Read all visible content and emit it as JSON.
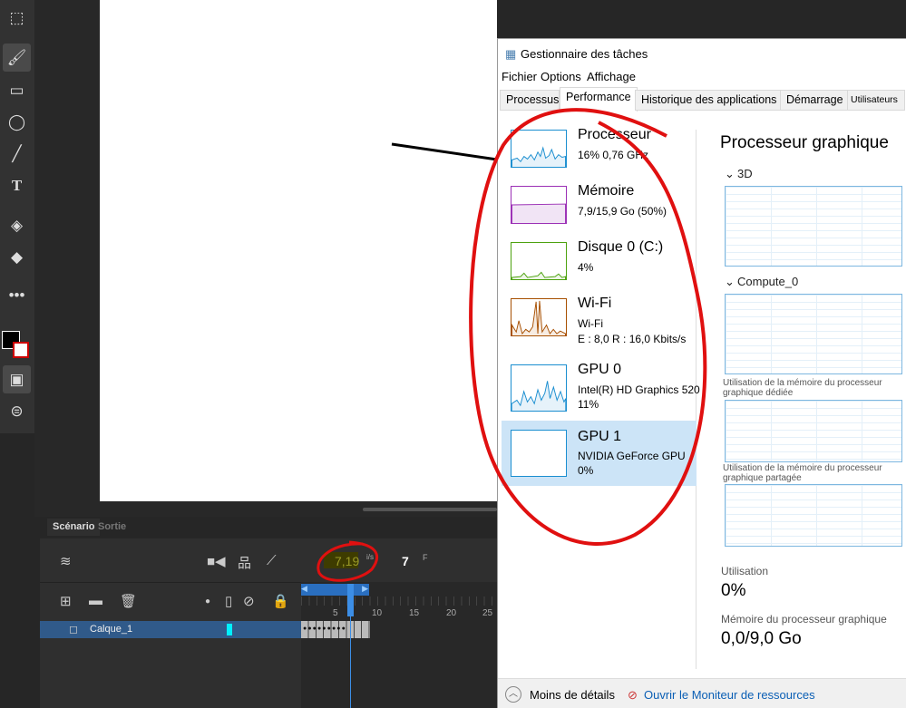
{
  "animate": {
    "timeline": {
      "tabs": [
        "Scénario",
        "Sortie"
      ],
      "fps": "7,19",
      "fps_unit": "i/s",
      "frame": "7",
      "frame_unit": "F",
      "ruler": [
        "5",
        "10",
        "15",
        "20",
        "25"
      ],
      "layer": "Calque_1"
    }
  },
  "task_manager": {
    "title": "Gestionnaire des tâches",
    "menu": [
      "Fichier",
      "Options",
      "Affichage"
    ],
    "tabs": [
      "Processus",
      "Performance",
      "Historique des applications",
      "Démarrage",
      "Utilisateurs"
    ],
    "active_tab": "Performance",
    "sidebar": [
      {
        "title": "Processeur",
        "sub": "16%  0,76 GHz",
        "color": "#1a8ed0"
      },
      {
        "title": "Mémoire",
        "sub": "7,9/15,9 Go (50%)",
        "color": "#9b2fb5"
      },
      {
        "title": "Disque 0 (C:)",
        "sub": "4%",
        "color": "#4da20f"
      },
      {
        "title": "Wi-Fi",
        "sub": "Wi-Fi",
        "sub2": "E : 8,0  R : 16,0 Kbits/s",
        "color": "#a74f01"
      },
      {
        "title": "GPU 0",
        "sub": "Intel(R) HD Graphics 520",
        "sub2": "11%",
        "color": "#1a8ed0"
      },
      {
        "title": "GPU 1",
        "sub": "NVIDIA GeForce GPU",
        "sub2": "0%",
        "color": "#1a8ed0",
        "selected": true
      }
    ],
    "main": {
      "title": "Processeur graphique",
      "engines": [
        "3D",
        "Compute_0"
      ],
      "mem_labels": [
        "Utilisation de la mémoire du processeur graphique dédiée",
        "Utilisation de la mémoire du processeur graphique partagée"
      ],
      "utilisation_label": "Utilisation",
      "utilisation": "0%",
      "memory_label": "Mémoire du processeur graphique",
      "memory": "0,0/9,0 Go"
    },
    "footer": {
      "less_details": "Moins de détails",
      "resource_monitor": "Ouvrir le Moniteur de ressources"
    }
  }
}
